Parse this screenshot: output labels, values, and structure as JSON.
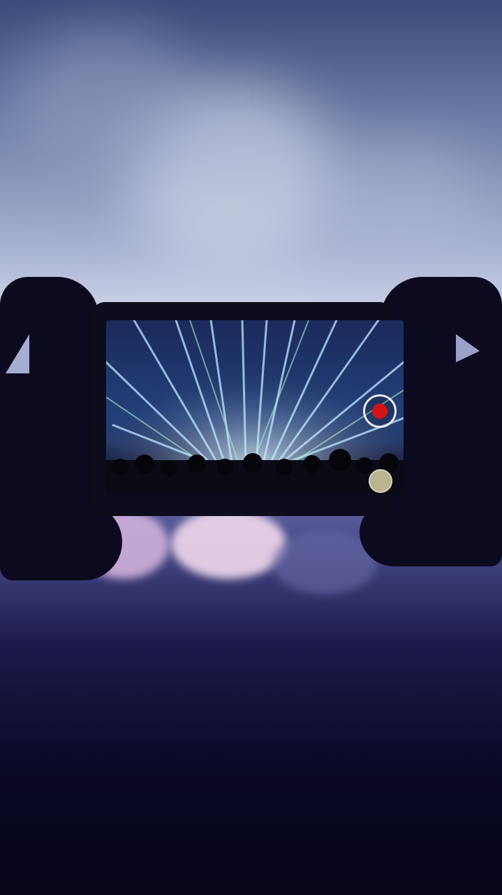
{
  "scene": {
    "subject": "hands-holding-phone-recording-concert",
    "phone_status_text": "",
    "colors": {
      "sky_light": "#c9cfe6",
      "sky_dark": "#3a4a78",
      "hands": "#0b0a1f",
      "record_red": "#d41414",
      "laser_cyan": "#bfe9ff"
    },
    "icons": {
      "record": "record-button-icon",
      "snapshot": "snapshot-button-icon"
    }
  }
}
